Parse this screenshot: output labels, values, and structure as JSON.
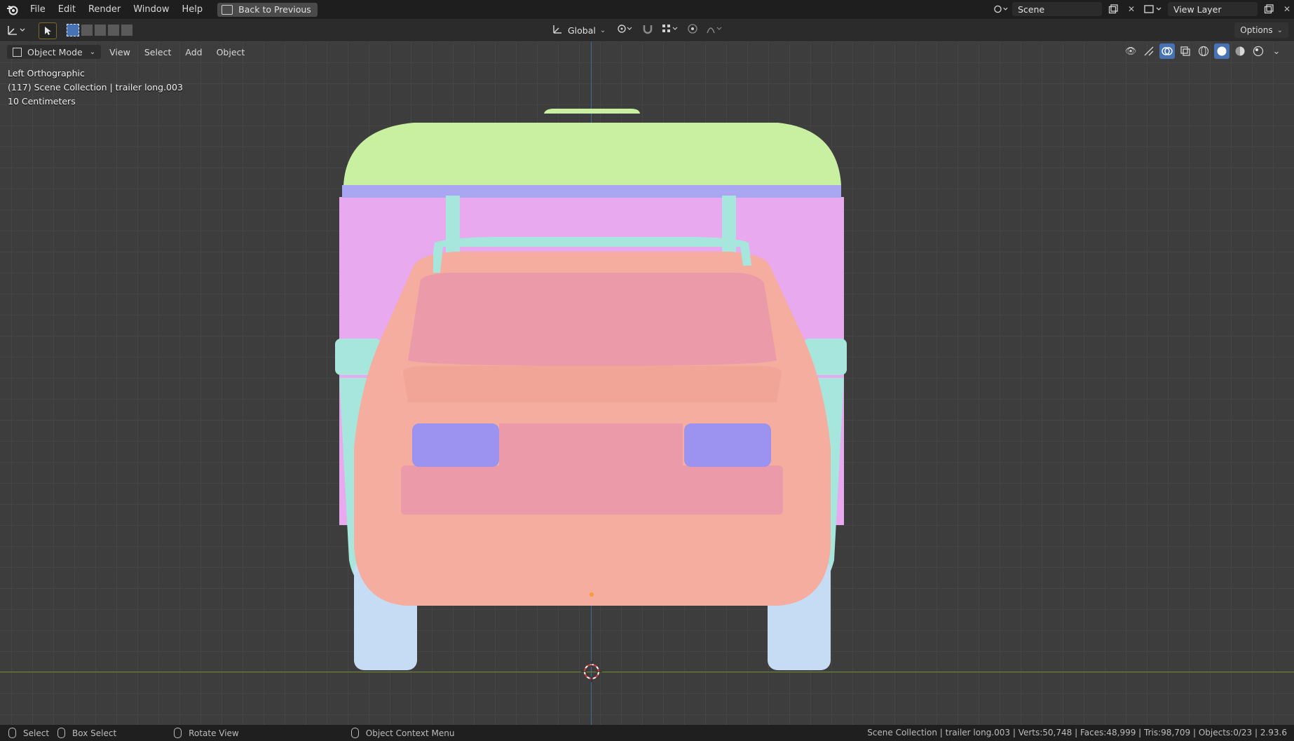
{
  "menu": {
    "items": [
      "File",
      "Edit",
      "Render",
      "Window",
      "Help"
    ],
    "back_label": "Back to Previous"
  },
  "top_right": {
    "scene_label": "Scene",
    "view_layer_label": "View Layer"
  },
  "toolbar": {
    "transform_orientation": "Global",
    "options_label": "Options"
  },
  "viewport_header": {
    "mode": "Object Mode",
    "menus": [
      "View",
      "Select",
      "Add",
      "Object"
    ]
  },
  "overlay": {
    "view_name": "Left Orthographic",
    "collection": "(117) Scene Collection | trailer long.003",
    "scale": "10 Centimeters"
  },
  "statusbar": {
    "select": "Select",
    "box_select": "Box Select",
    "rotate_view": "Rotate View",
    "context_menu": "Object Context Menu",
    "stats": "Scene Collection | trailer long.003 | Verts:50,748 | Faces:48,999 | Tris:98,709 | Objects:0/23 | 2.93.6"
  },
  "colors": {
    "camper_roof": "#c9f0a0",
    "camper_body": "#e9a9ee",
    "trim": "#a9a6f2",
    "mirror": "#a6e6dd",
    "car_body": "#f4ad9e",
    "window": "#eb9aa9",
    "light": "#9b93ef",
    "tire": "#c6dcf4"
  }
}
